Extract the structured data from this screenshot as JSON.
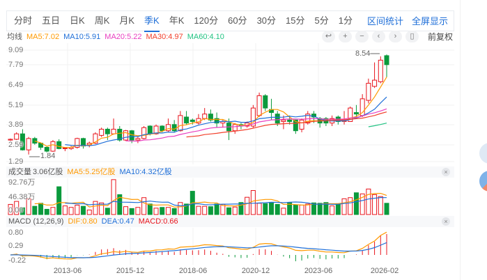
{
  "tabs": [
    "分时",
    "五日",
    "日K",
    "周K",
    "月K",
    "季K",
    "年K",
    "120分",
    "60分",
    "30分",
    "15分",
    "5分",
    "1分"
  ],
  "active_tab": "季K",
  "tab_actions": [
    "区间统计",
    "全屏显示"
  ],
  "ma_legend": {
    "title": "均线",
    "items": [
      {
        "text": "MA5:7.02",
        "color": "#ff9900"
      },
      {
        "text": "MA10:5.91",
        "color": "#1f6fd8"
      },
      {
        "text": "MA20:5.22",
        "color": "#e83ec0"
      },
      {
        "text": "MA30:4.97",
        "color": "#f2402c"
      },
      {
        "text": "MA60:4.10",
        "color": "#21c383"
      }
    ]
  },
  "toolbar": {
    "icons": [
      "undo-icon",
      "zoom-in-icon",
      "zoom-out-icon",
      "prev-icon",
      "next-icon",
      "candle-type-icon"
    ],
    "glyphs": [
      "↩",
      "+",
      "−",
      "‹",
      "›",
      "▯"
    ],
    "adjust": "前复权"
  },
  "price_ticks": [
    "9.09",
    "7.79",
    "6.49",
    "5.19",
    "3.89",
    "2.59",
    "1.29"
  ],
  "annotations": {
    "high": "8.54",
    "low": "1.84"
  },
  "volume": {
    "title": "成交量",
    "total": "3.06亿股",
    "ma5": "MA5:5.25亿股",
    "ma10": "MA10:4.32亿股",
    "ticks": [
      "92.76万",
      "46.38万",
      "0.00"
    ],
    "close": "×"
  },
  "macd": {
    "title": "MACD (12,26,9)",
    "dif": "DIF:0.80",
    "dea": "DEA:0.47",
    "macd": "MACD:0.66",
    "ticks": [
      "0.80",
      "0.29",
      "-0.22"
    ],
    "close": "×"
  },
  "dates": [
    "2013-06",
    "2015-12",
    "2018-06",
    "2020-12",
    "2023-06",
    "2026-02"
  ],
  "colors": {
    "up": "#e8141c",
    "down": "#0a9a3c",
    "accent": "#1f6fd8"
  },
  "candles": [
    [
      2.9,
      2.95,
      3.0,
      2.85
    ],
    [
      2.95,
      3.3,
      3.4,
      2.9
    ],
    [
      3.3,
      2.2,
      3.6,
      2.15
    ],
    [
      2.2,
      3.0,
      3.1,
      1.84
    ],
    [
      3.0,
      2.7,
      3.1,
      2.6
    ],
    [
      2.7,
      2.4,
      2.75,
      2.2
    ],
    [
      2.4,
      2.1,
      2.45,
      2.0
    ],
    [
      2.1,
      2.8,
      2.9,
      2.05
    ],
    [
      2.8,
      2.3,
      2.95,
      2.25
    ],
    [
      2.3,
      2.35,
      2.4,
      2.1
    ],
    [
      2.3,
      2.4,
      2.5,
      2.2
    ],
    [
      2.4,
      3.0,
      3.05,
      2.3
    ],
    [
      3.0,
      2.5,
      3.05,
      2.3
    ],
    [
      2.6,
      2.7,
      2.8,
      2.4
    ],
    [
      2.7,
      3.3,
      3.4,
      2.65
    ],
    [
      3.2,
      3.6,
      3.7,
      3.1
    ],
    [
      3.6,
      3.3,
      3.7,
      2.9
    ],
    [
      3.3,
      3.6,
      4.3,
      3.25
    ],
    [
      3.6,
      2.9,
      3.8,
      2.8
    ],
    [
      2.9,
      3.5,
      3.55,
      2.85
    ],
    [
      3.5,
      2.9,
      3.55,
      2.7
    ],
    [
      2.9,
      3.0,
      3.1,
      2.7
    ],
    [
      3.0,
      3.7,
      3.8,
      2.95
    ],
    [
      3.8,
      3.3,
      3.85,
      3.2
    ],
    [
      3.3,
      3.8,
      3.9,
      3.25
    ],
    [
      3.8,
      3.5,
      3.85,
      3.4
    ],
    [
      3.5,
      3.9,
      4.3,
      3.4
    ],
    [
      3.9,
      3.5,
      4.2,
      3.4
    ],
    [
      3.5,
      4.5,
      4.8,
      3.45
    ],
    [
      4.4,
      4.0,
      4.8,
      3.9
    ],
    [
      4.2,
      4.1,
      4.3,
      3.9
    ],
    [
      4.0,
      4.3,
      4.6,
      3.9
    ],
    [
      4.3,
      4.6,
      5.0,
      4.2
    ],
    [
      4.6,
      4.2,
      4.9,
      4.1
    ],
    [
      4.3,
      4.0,
      4.7,
      3.7
    ],
    [
      4.0,
      4.1,
      4.2,
      3.7
    ],
    [
      4.0,
      3.5,
      4.3,
      2.9
    ],
    [
      3.5,
      3.9,
      4.0,
      3.3
    ],
    [
      3.9,
      3.8,
      4.0,
      3.6
    ],
    [
      3.8,
      4.0,
      4.1,
      3.7
    ],
    [
      3.8,
      5.0,
      5.2,
      3.7
    ],
    [
      4.5,
      5.8,
      6.0,
      4.4
    ],
    [
      5.8,
      5.0,
      5.9,
      4.8
    ],
    [
      4.9,
      4.7,
      5.6,
      4.2
    ],
    [
      4.6,
      4.0,
      4.8,
      3.8
    ],
    [
      4.1,
      4.2,
      4.5,
      3.6
    ],
    [
      4.2,
      4.1,
      4.5,
      3.9
    ],
    [
      4.2,
      3.5,
      4.2,
      3.3
    ],
    [
      3.6,
      4.2,
      4.3,
      3.4
    ],
    [
      4.0,
      4.6,
      4.8,
      3.9
    ],
    [
      4.6,
      4.4,
      4.8,
      4.0
    ],
    [
      4.3,
      4.0,
      4.4,
      3.7
    ],
    [
      4.3,
      4.0,
      4.4,
      3.8
    ],
    [
      4.0,
      4.3,
      4.5,
      3.8
    ],
    [
      4.4,
      4.1,
      4.5,
      3.9
    ],
    [
      4.1,
      4.2,
      4.8,
      3.9
    ],
    [
      4.1,
      5.0,
      5.1,
      4.1
    ],
    [
      4.7,
      4.6,
      5.2,
      4.3
    ],
    [
      4.5,
      5.6,
      5.9,
      4.4
    ],
    [
      5.5,
      6.6,
      6.9,
      5.3
    ],
    [
      6.4,
      6.8,
      8.0,
      6.3
    ],
    [
      6.7,
      8.2,
      8.54,
      6.6
    ],
    [
      8.6,
      7.8,
      8.7,
      7.0
    ]
  ],
  "volumes": [
    27,
    35,
    18,
    42,
    22,
    30,
    14,
    19,
    74,
    23,
    19,
    25,
    22,
    12,
    35,
    31,
    17,
    93,
    53,
    21,
    16,
    19,
    45,
    28,
    17,
    19,
    19,
    16,
    32,
    28,
    62,
    22,
    22,
    21,
    28,
    27,
    18,
    20,
    32,
    46,
    64,
    30,
    29,
    32,
    27,
    17,
    32,
    25,
    25,
    28,
    31,
    30,
    32,
    23,
    29,
    42,
    45,
    58,
    55,
    68,
    53,
    48,
    30
  ]
}
